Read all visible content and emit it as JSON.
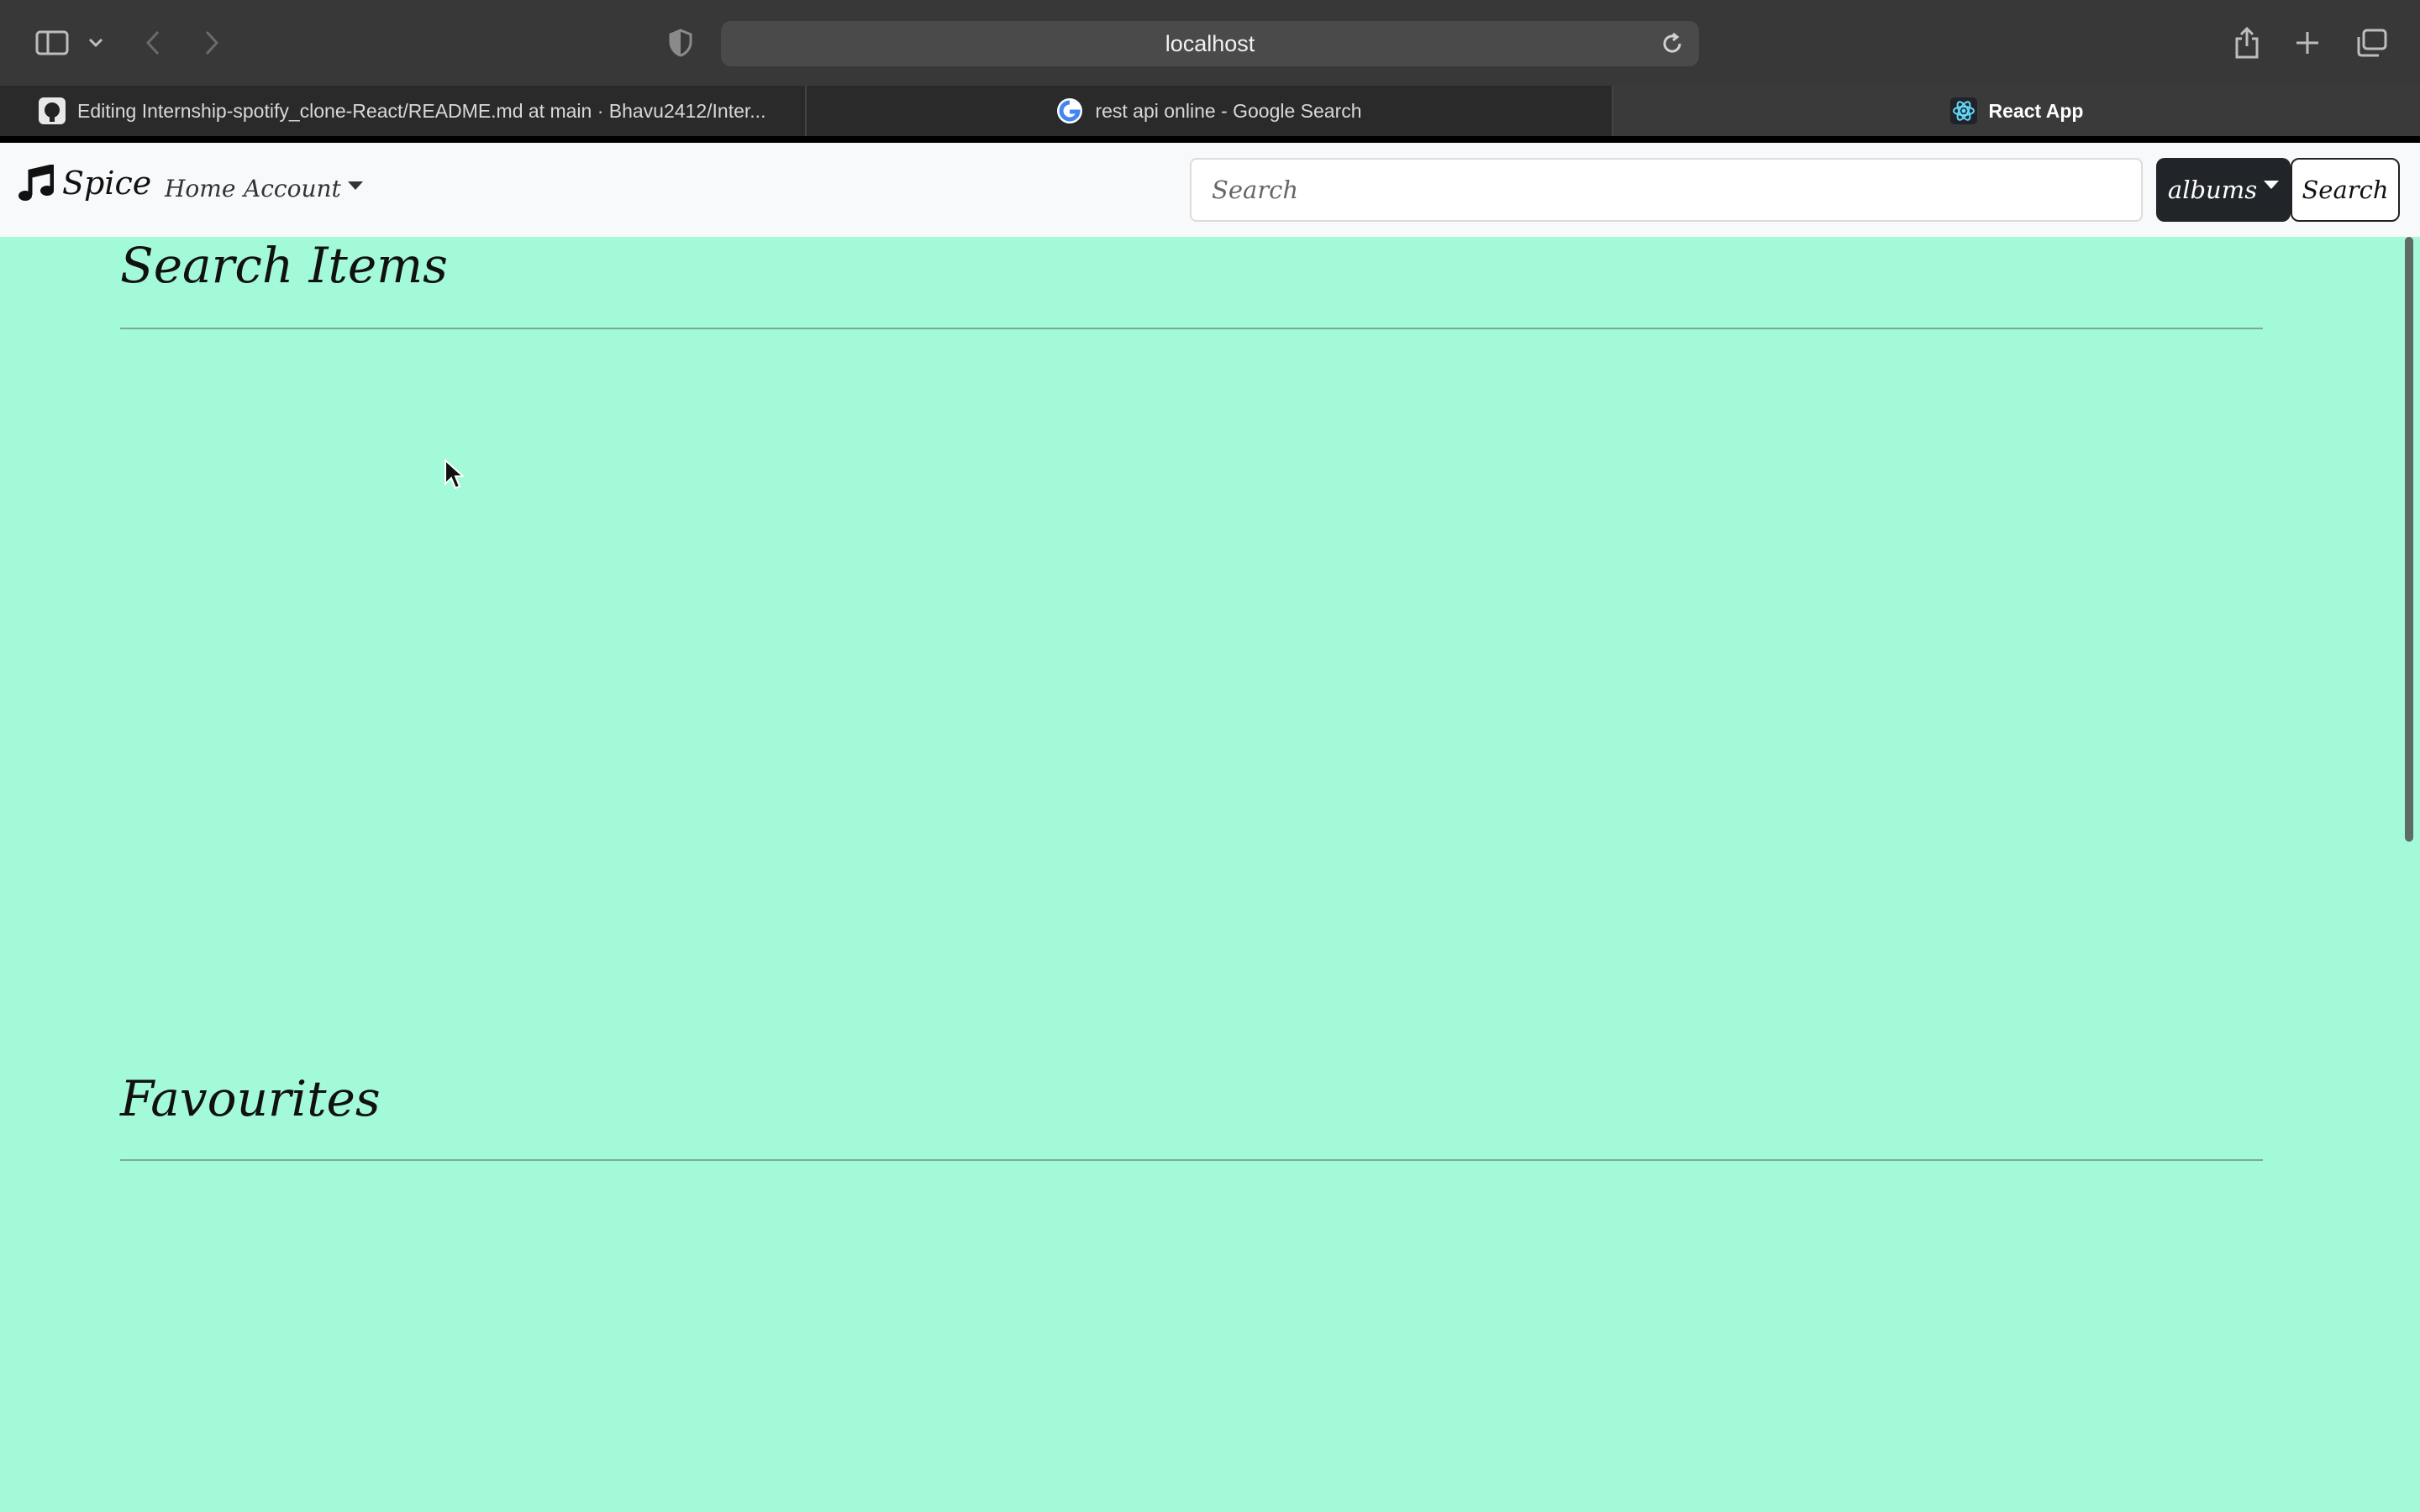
{
  "browser": {
    "url": "localhost",
    "tabs": [
      {
        "title": "Editing Internship-spotify_clone-React/README.md at main · Bhavu2412/Inter...",
        "favicon": "github-icon",
        "active": false
      },
      {
        "title": "rest api online - Google Search",
        "favicon": "google-icon",
        "active": false
      },
      {
        "title": "React App",
        "favicon": "react-icon",
        "active": true
      }
    ]
  },
  "navbar": {
    "brand": "Spice",
    "brand_icon": "music-note-icon",
    "links": {
      "home": "Home",
      "account": "Account"
    },
    "search_placeholder": "Search",
    "type_select": "albums",
    "search_button": "Search"
  },
  "sections": {
    "search_items": "Search Items",
    "favourites": "Favourites"
  },
  "colors": {
    "page_background": "#a2fad8",
    "navbar_background": "#f8f9fa",
    "dark_button": "#212529"
  }
}
